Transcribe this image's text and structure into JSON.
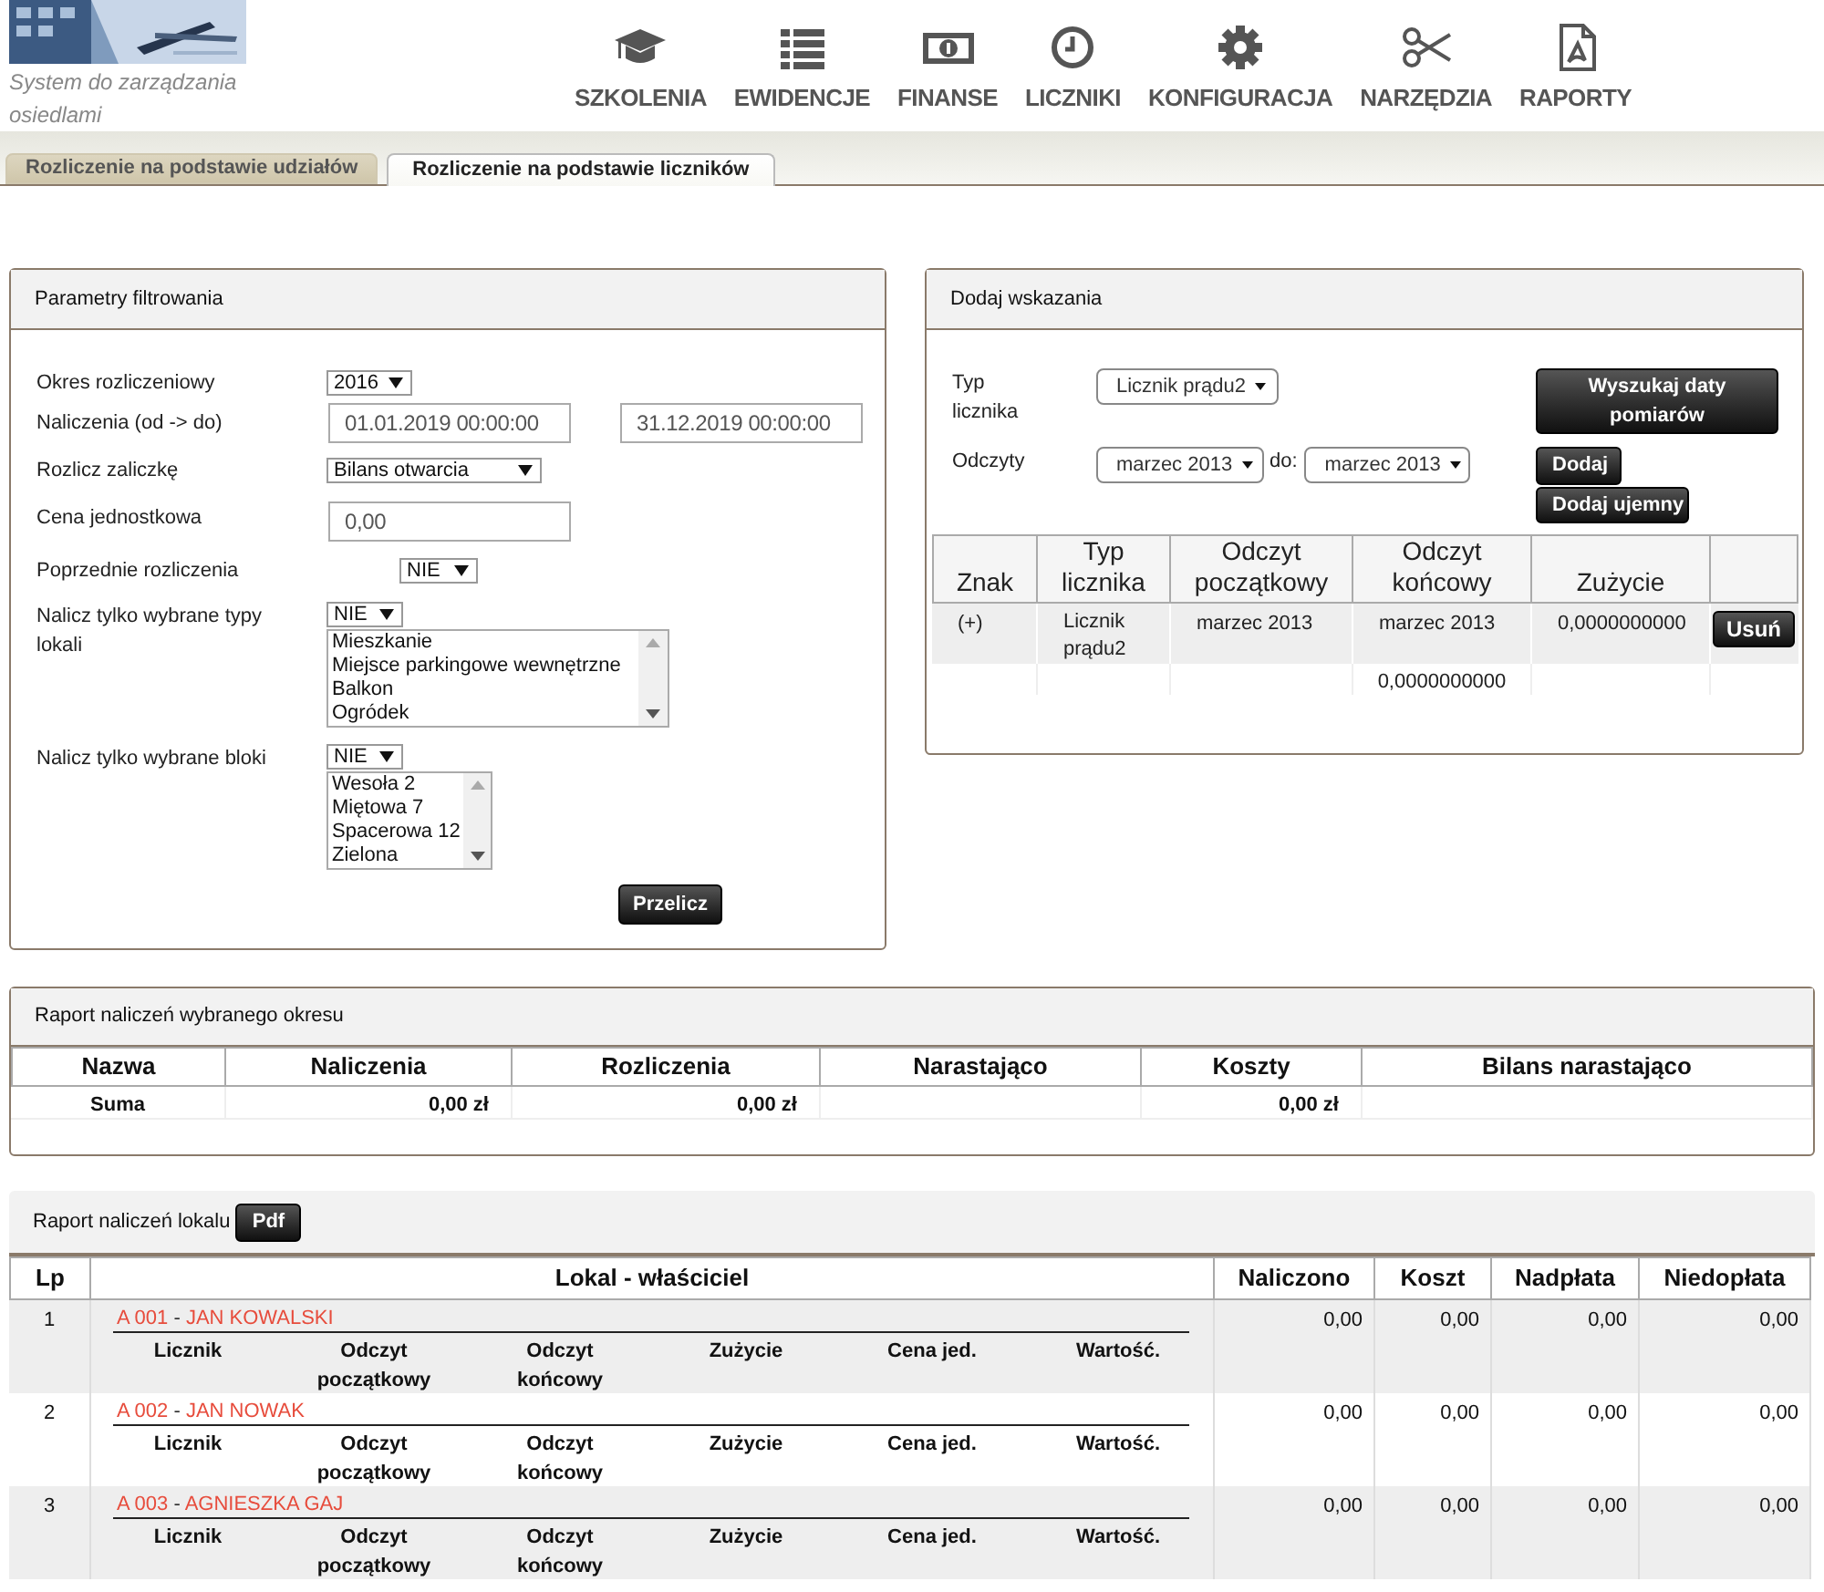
{
  "header": {
    "caption": "System do zarządzania osiedlami",
    "nav": [
      {
        "label": "SZKOLENIA"
      },
      {
        "label": "EWIDENCJE"
      },
      {
        "label": "FINANSE"
      },
      {
        "label": "LICZNIKI"
      },
      {
        "label": "KONFIGURACJA"
      },
      {
        "label": "NARZĘDZIA"
      },
      {
        "label": "RAPORTY"
      }
    ]
  },
  "tabs": [
    {
      "label": "Rozliczenie na podstawie udziałów",
      "selected": false
    },
    {
      "label": "Rozliczenie na podstawie liczników",
      "selected": true
    }
  ],
  "filter": {
    "title": "Parametry filtrowania",
    "period": {
      "label": "Okres rozliczeniowy",
      "value": "2016"
    },
    "range": {
      "label": "Naliczenia (od -> do)",
      "from": "01.01.2019 00:00:00",
      "to": "31.12.2019 00:00:00"
    },
    "advance": {
      "label": "Rozlicz zaliczkę",
      "value": "Bilans otwarcia"
    },
    "price": {
      "label": "Cena jednostkowa",
      "value": "0,00"
    },
    "previous": {
      "label": "Poprzednie rozliczenia",
      "value": "NIE"
    },
    "types": {
      "label": "Nalicz tylko wybrane typy lokali",
      "value": "NIE",
      "options": [
        "Mieszkanie",
        "Miejsce parkingowe wewnętrzne",
        "Balkon",
        "Ogródek"
      ]
    },
    "blocks": {
      "label": "Nalicz tylko wybrane bloki",
      "value": "NIE",
      "options": [
        "Wesoła 2",
        "Miętowa 7",
        "Spacerowa 12",
        "Zielona"
      ]
    },
    "button": "Przelicz"
  },
  "readings": {
    "title": "Dodaj wskazania",
    "type_label": "Typ licznika",
    "type_value": "Licznik prądu2",
    "readings_label": "Odczyty",
    "from": "marzec 2013",
    "to_label": "do:",
    "to": "marzec 2013",
    "search_button": "Wyszukaj daty pomiarów",
    "add_button": "Dodaj",
    "add_negative_button": "Dodaj ujemny",
    "columns": [
      "Znak",
      "Typ licznika",
      "Odczyt początkowy",
      "Odczyt końcowy",
      "Zużycie"
    ],
    "rows": [
      {
        "sign": "(+)",
        "type": "Licznik prądu2",
        "start": "marzec 2013",
        "end": "marzec 2013",
        "usage": "0,0000000000",
        "action": "Usuń"
      }
    ],
    "total": "0,0000000000"
  },
  "period_report": {
    "title": "Raport naliczeń wybranego okresu",
    "columns": [
      "Nazwa",
      "Naliczenia",
      "Rozliczenia",
      "Narastająco",
      "Koszty",
      "Bilans narastająco"
    ],
    "rows": [
      {
        "name": "Suma",
        "charges": "0,00 zł",
        "settlements": "0,00 zł",
        "cumulative": "",
        "costs": "0,00 zł",
        "balance": ""
      }
    ]
  },
  "unit_report": {
    "title": "Raport naliczeń lokalu",
    "pdf_button": "Pdf",
    "columns": [
      "Lp",
      "Lokal - właściciel",
      "Naliczono",
      "Koszt",
      "Nadpłata",
      "Niedopłata"
    ],
    "rows": [
      {
        "lp": "1",
        "unit": "A 001",
        "separator": "-",
        "owner": "JAN KOWALSKI",
        "sub_columns": [
          "Licznik",
          "Odczyt początkowy",
          "Odczyt końcowy",
          "Zużycie",
          "Cena jed.",
          "Wartość."
        ],
        "charged": "0,00",
        "cost": "0,00",
        "overpaid": "0,00",
        "underpaid": "0,00"
      },
      {
        "lp": "2",
        "unit": "A 002",
        "separator": "-",
        "owner": "JAN NOWAK",
        "sub_columns": [
          "Licznik",
          "Odczyt początkowy",
          "Odczyt końcowy",
          "Zużycie",
          "Cena jed.",
          "Wartość."
        ],
        "charged": "0,00",
        "cost": "0,00",
        "overpaid": "0,00",
        "underpaid": "0,00"
      },
      {
        "lp": "3",
        "unit": "A 003",
        "separator": "-",
        "owner": "AGNIESZKA GAJ",
        "sub_columns": [
          "Licznik",
          "Odczyt początkowy",
          "Odczyt końcowy",
          "Zużycie",
          "Cena jed.",
          "Wartość."
        ],
        "charged": "0,00",
        "cost": "0,00",
        "overpaid": "0,00",
        "underpaid": "0,00"
      }
    ]
  }
}
